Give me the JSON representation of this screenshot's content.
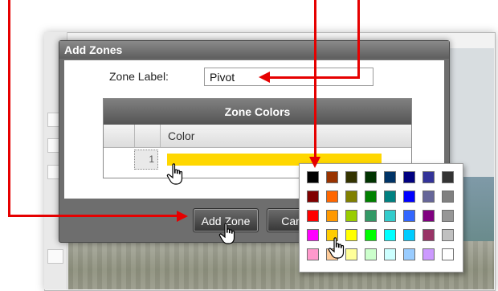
{
  "dialog": {
    "title": "Add Zones",
    "zone_label": "Zone Label:",
    "zone_label_value": "Pivot",
    "table": {
      "caption": "Zone Colors",
      "columns": [
        "Color"
      ],
      "rows": [
        {
          "number": "1",
          "color": "#ffd700"
        }
      ]
    },
    "buttons": {
      "add": "Add Zone",
      "cancel": "Cancel"
    }
  },
  "color_picker": {
    "selected_color": "#ffd700",
    "swatches": [
      [
        "#000000",
        "#993300",
        "#333300",
        "#003300",
        "#003366",
        "#000080",
        "#333399",
        "#333333"
      ],
      [
        "#800000",
        "#ff6600",
        "#808000",
        "#008000",
        "#008080",
        "#0000ff",
        "#666699",
        "#808080"
      ],
      [
        "#ff0000",
        "#ff9900",
        "#99cc00",
        "#339966",
        "#33cccc",
        "#3366ff",
        "#800080",
        "#969696"
      ],
      [
        "#ff00ff",
        "#ffcc00",
        "#ffff00",
        "#00ff00",
        "#00ffff",
        "#00ccff",
        "#993366",
        "#c0c0c0"
      ],
      [
        "#ff99cc",
        "#ffcc99",
        "#ffff99",
        "#ccffcc",
        "#ccffff",
        "#99ccff",
        "#cc99ff",
        "#ffffff"
      ]
    ]
  },
  "colors": {
    "annotation_arrow": "#e60000",
    "accent_yellow": "#ffd700"
  },
  "icons": {
    "cursor": "hand-pointer-icon"
  }
}
